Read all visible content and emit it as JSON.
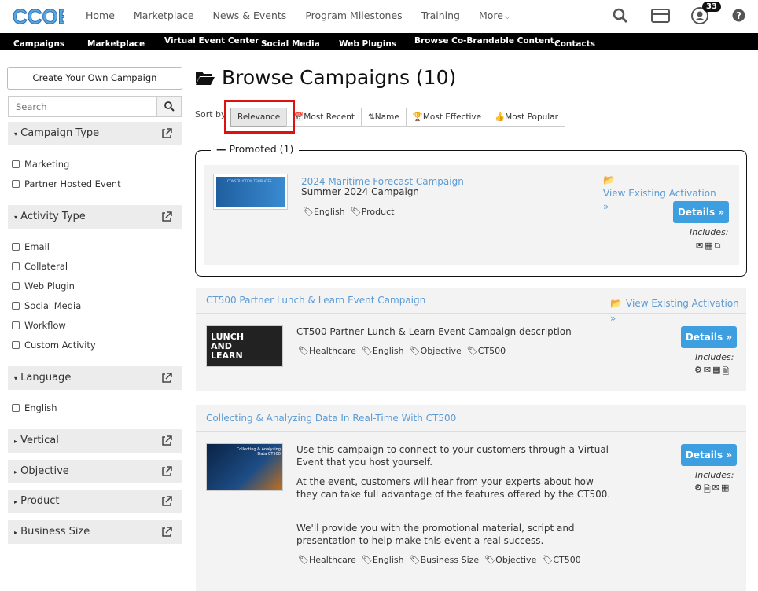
{
  "brand": {
    "logo_text": "CCOE",
    "accent": "#3d9ee0"
  },
  "topnav": {
    "items": [
      "Home",
      "Marketplace",
      "News & Events",
      "Program Milestones",
      "Training",
      "More"
    ],
    "notification_count": "33"
  },
  "subnav": {
    "items": [
      "Campaigns",
      "Marketplace",
      "Virtual Event Center",
      "Social Media",
      "Web Plugins",
      "Browse Co-Brandable Content",
      "Contacts"
    ]
  },
  "sidebar": {
    "create_label": "Create Your Own Campaign",
    "search_placeholder": "Search",
    "facets": {
      "campaign_type": {
        "label": "Campaign Type",
        "options": [
          "Marketing",
          "Partner Hosted Event"
        ]
      },
      "activity_type": {
        "label": "Activity Type",
        "options": [
          "Email",
          "Collateral",
          "Web Plugin",
          "Social Media",
          "Workflow",
          "Custom Activity"
        ]
      },
      "language": {
        "label": "Language",
        "options": [
          "English"
        ]
      },
      "vertical": {
        "label": "Vertical"
      },
      "objective": {
        "label": "Objective"
      },
      "product": {
        "label": "Product"
      },
      "business_size": {
        "label": "Business Size"
      }
    }
  },
  "main": {
    "title": "Browse Campaigns (10)",
    "sort_label": "Sort by",
    "sort_options": [
      "Relevance",
      "Most Recent",
      "Name",
      "Most Effective",
      "Most Popular"
    ],
    "promoted_label": "Promoted (1)"
  },
  "campaigns": [
    {
      "title": "2024 Maritime Forecast Campaign",
      "subtitle": "Summer 2024 Campaign",
      "tags": [
        "English",
        "Product"
      ],
      "view_label": "View Existing Activation",
      "details_label": "Details",
      "includes_label": "Includes:",
      "thumb_text": "CONSTRUCTION TEMPLATES"
    },
    {
      "title": "CT500 Partner Lunch & Learn Event Campaign",
      "desc": "CT500 Partner Lunch & Learn Event Campaign description",
      "tags": [
        "Healthcare",
        "English",
        "Objective",
        "CT500"
      ],
      "view_label": "View Existing Activation",
      "details_label": "Details",
      "includes_label": "Includes:",
      "thumb_text": "LUNCH AND LEARN"
    },
    {
      "title": "Collecting & Analyzing Data In Real-Time With CT500",
      "desc1": "Use this campaign to connect to your customers through a Virtual Event that you host yourself.",
      "desc2": "At the event, customers will hear from your experts about how they can take full advantage of the features offered by the CT500.",
      "desc3": "We'll provide you with the promotional material, script and presentation to help make this event a real success.",
      "tags": [
        "Healthcare",
        "English",
        "Business Size",
        "Objective",
        "CT500"
      ],
      "details_label": "Details",
      "includes_label": "Includes:",
      "thumb_text": "Collecting & Analyzing Data CT500"
    }
  ]
}
